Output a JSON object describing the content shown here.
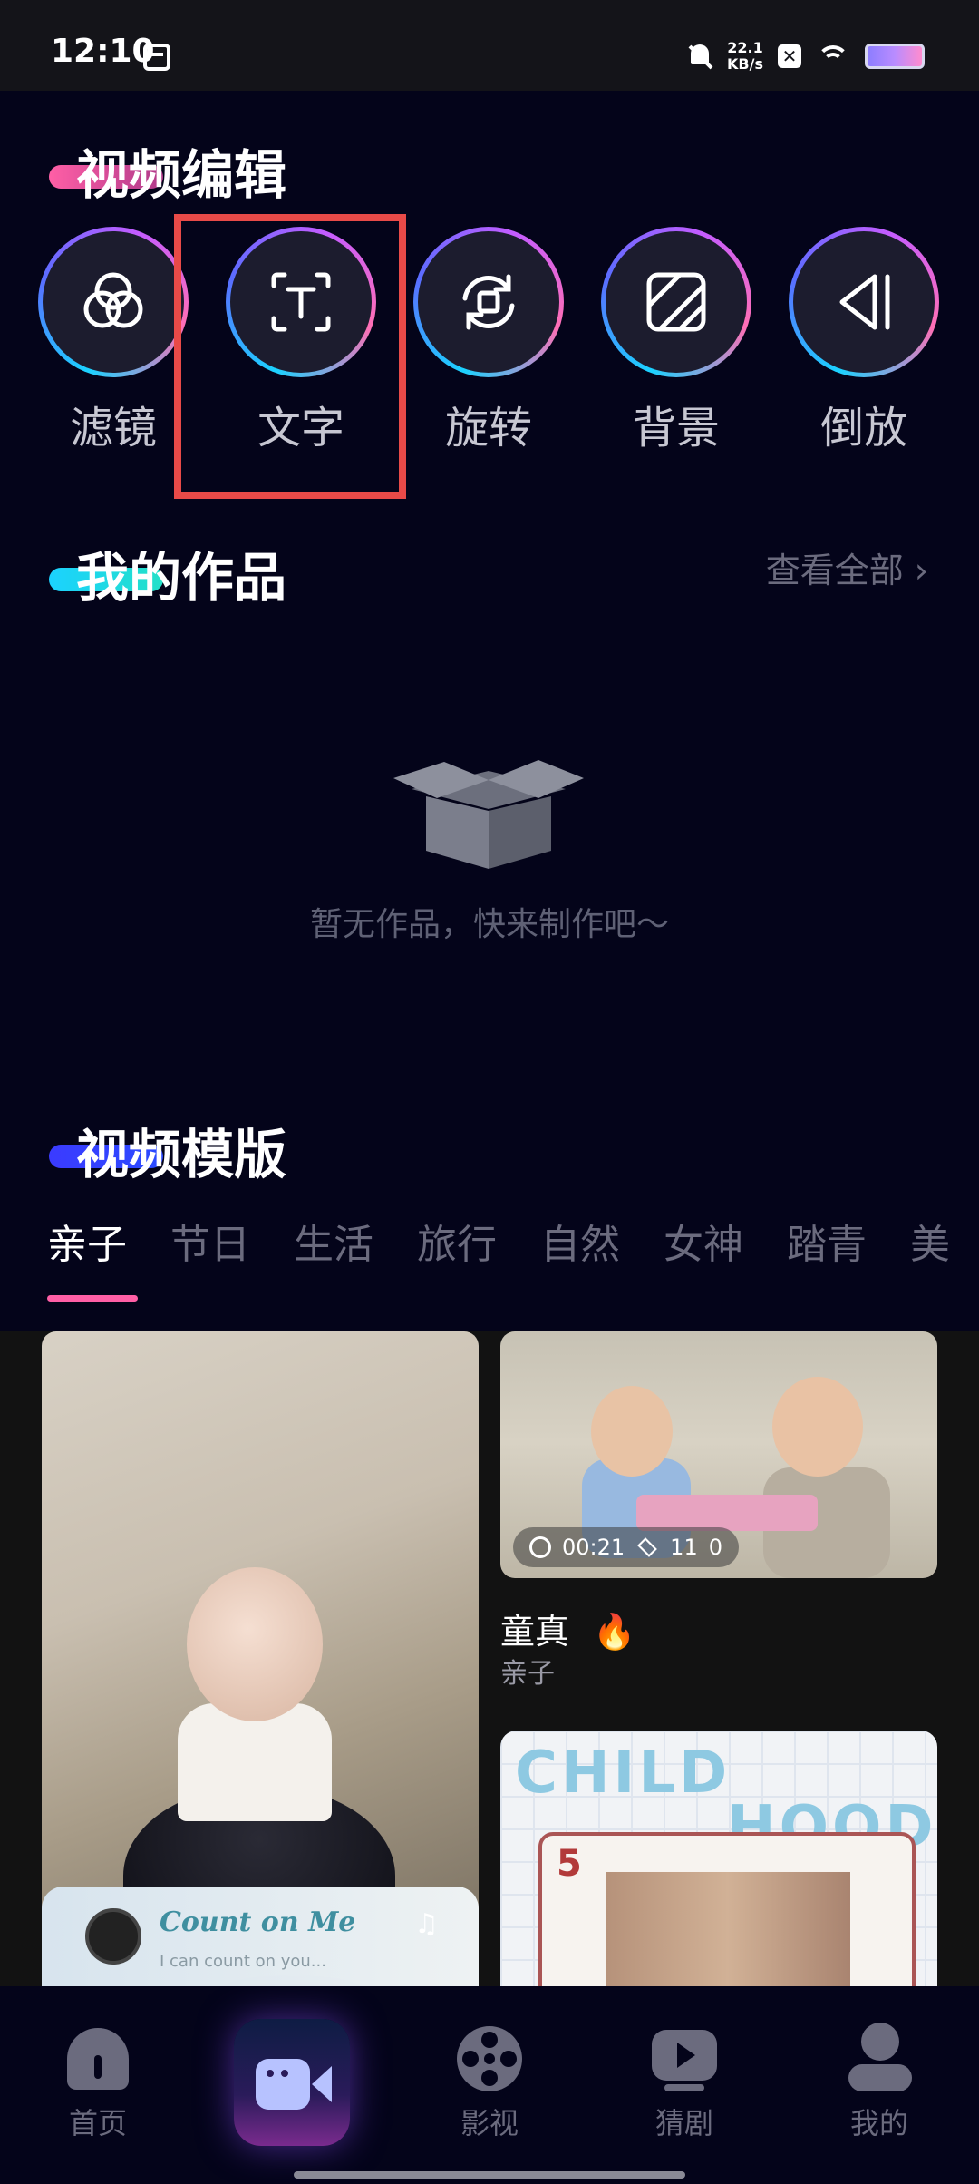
{
  "status_bar": {
    "time": "12:10",
    "speed_value": "22.1",
    "speed_unit": "KB/s"
  },
  "video_edit": {
    "title": "视频编辑",
    "tools": [
      {
        "label": "滤镜",
        "icon": "filter-icon"
      },
      {
        "label": "文字",
        "icon": "text-icon"
      },
      {
        "label": "旋转",
        "icon": "rotate-icon"
      },
      {
        "label": "背景",
        "icon": "background-icon"
      },
      {
        "label": "倒放",
        "icon": "reverse-icon"
      }
    ]
  },
  "my_works": {
    "title": "我的作品",
    "see_all": "查看全部 ›",
    "empty_text": "暂无作品，快来制作吧～"
  },
  "templates": {
    "title": "视频模版",
    "tabs": [
      "亲子",
      "节日",
      "生活",
      "旅行",
      "自然",
      "女神",
      "踏青",
      "美"
    ],
    "active_tab": "亲子",
    "cards": {
      "left": {
        "music_title": "Count on Me",
        "music_sub": "I can count on you..."
      },
      "top_right": {
        "duration": "00:21",
        "layers": "11",
        "count": "0",
        "title": "童真",
        "category": "亲子"
      },
      "bottom_right": {
        "art_word_1": "CHILD",
        "art_word_2": "HOOD",
        "card_number": "5"
      }
    }
  },
  "bottom_nav": {
    "items": [
      {
        "label": "首页",
        "icon": "home-icon"
      },
      {
        "label": "",
        "icon": "video-camera-icon"
      },
      {
        "label": "影视",
        "icon": "film-reel-icon"
      },
      {
        "label": "猜剧",
        "icon": "play-icon"
      },
      {
        "label": "我的",
        "icon": "profile-icon"
      }
    ]
  },
  "colors": {
    "background": "#04041a",
    "highlight": "#e84a48",
    "accent_pink": "#ff5fa6",
    "accent_cyan": "#1bd2ff"
  }
}
